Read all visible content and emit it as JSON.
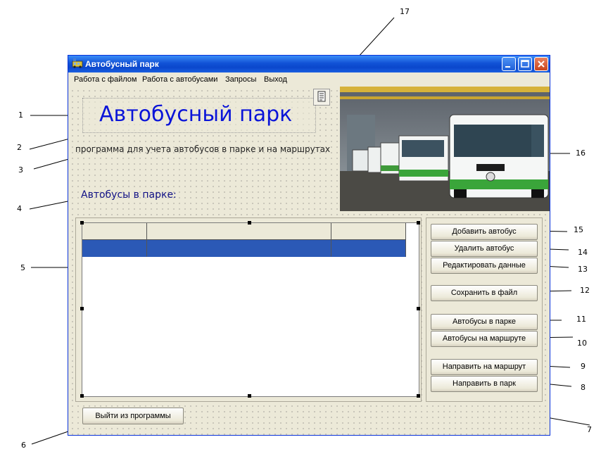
{
  "window": {
    "title": "Автобусный парк"
  },
  "menu": [
    "Работа с файлом",
    "Работа с автобусами",
    "Запросы",
    "Выход"
  ],
  "logo_text": "Автобусный парк",
  "subtitle": "программа для учета автобусов в парке и на маршрутах",
  "section_label": "Автобусы в парке:",
  "buttons": {
    "add_bus": "Добавить автобус",
    "delete_bus": "Удалить автобус",
    "edit_data": "Редактировать данные",
    "save_file": "Сохранить в файл",
    "buses_in_park": "Автобусы в парке",
    "buses_on_route": "Автобусы на маршруте",
    "send_to_route": "Направить на маршрут",
    "send_to_park": "Направить в парк",
    "exit_program": "Выйти из программы"
  },
  "callouts": {
    "c1": "1",
    "c2": "2",
    "c3": "3",
    "c4": "4",
    "c5": "5",
    "c6": "6",
    "c7": "7",
    "c8": "8",
    "c9": "9",
    "c10": "10",
    "c11": "11",
    "c12": "12",
    "c13": "13",
    "c14": "14",
    "c15": "15",
    "c16": "16",
    "c17": "17"
  },
  "colors": {
    "titlebar": "#0a47cc",
    "selection": "#2b59b6",
    "logo": "#0a14d8"
  }
}
